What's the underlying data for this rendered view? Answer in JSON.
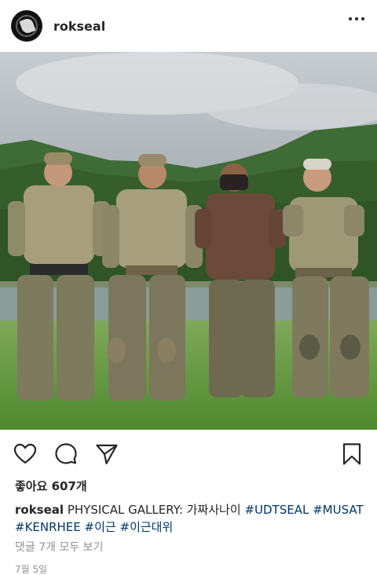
{
  "post": {
    "username": "rokseal",
    "likes": "좋아요 607개",
    "caption_username": "rokseal",
    "caption_text": "PHYSICAL GALLERY: 가짜사나이",
    "hashtags": [
      "#UDTSEAL",
      "#MUSAT",
      "#KENRHEE",
      "#이근",
      "#이근대위"
    ],
    "view_comments": "댓글 7개 모두 보기",
    "date": "7월 5일"
  },
  "icons": {
    "more": "more-options-icon",
    "like": "heart-icon",
    "comment": "comment-bubble-icon",
    "share": "paper-plane-icon",
    "save": "bookmark-icon"
  },
  "colors": {
    "text": "#262626",
    "hashtag": "#003569",
    "muted": "#8e8e8e"
  }
}
